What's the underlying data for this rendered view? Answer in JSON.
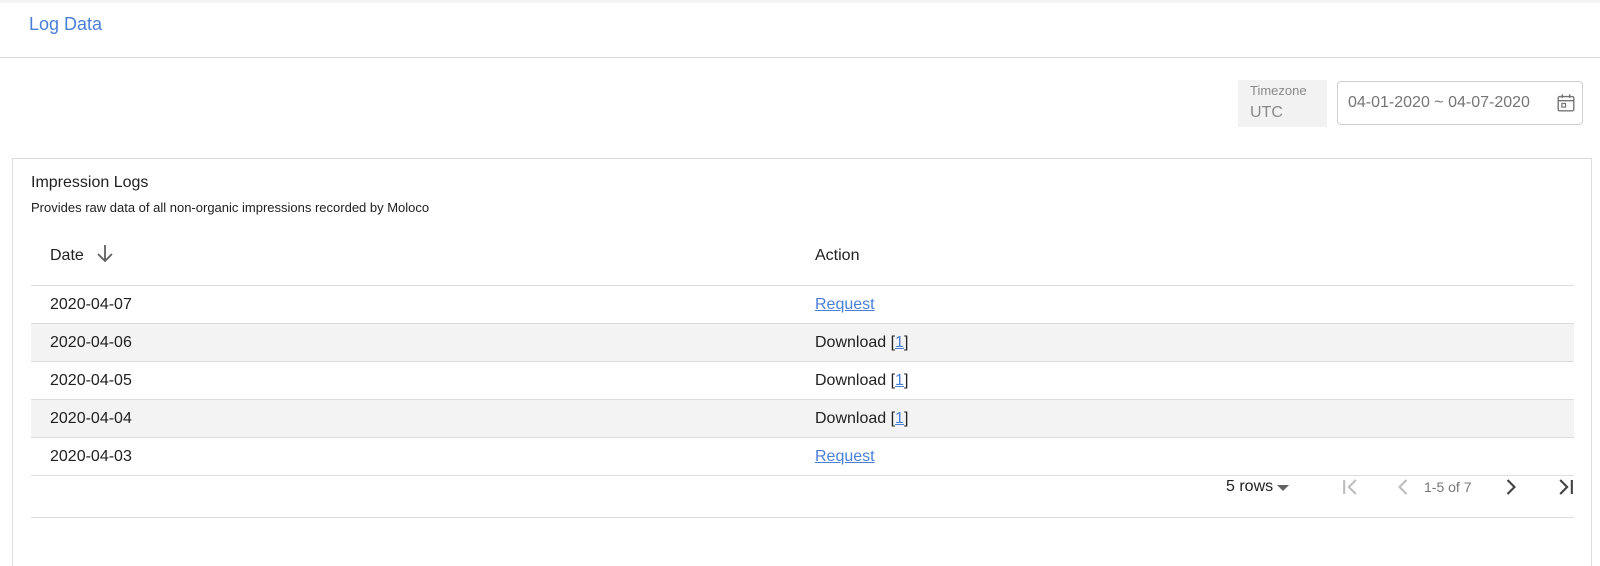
{
  "header": {
    "title": "Log Data"
  },
  "filters": {
    "timezone_label": "Timezone",
    "timezone_value": "UTC",
    "date_range": "04-01-2020 ~ 04-07-2020"
  },
  "card": {
    "title": "Impression Logs",
    "subtitle": "Provides raw data of all non-organic impressions recorded by Moloco"
  },
  "table": {
    "columns": [
      "Date",
      "Action"
    ],
    "rows": [
      {
        "date": "2020-04-07",
        "action_type": "request",
        "action_label": "Request"
      },
      {
        "date": "2020-04-06",
        "action_type": "download",
        "action_label": "Download",
        "files": [
          "1"
        ]
      },
      {
        "date": "2020-04-05",
        "action_type": "download",
        "action_label": "Download",
        "files": [
          "1"
        ]
      },
      {
        "date": "2020-04-04",
        "action_type": "download",
        "action_label": "Download",
        "files": [
          "1"
        ]
      },
      {
        "date": "2020-04-03",
        "action_type": "request",
        "action_label": "Request"
      }
    ]
  },
  "pagination": {
    "rows_per_page": "5 rows",
    "range_text": "1-5 of 7"
  },
  "colors": {
    "link": "#4a7fd8",
    "row_alt": "#f3f3f3",
    "border": "#dcdcdc"
  },
  "icons": {
    "sort": "arrow-down-icon",
    "calendar": "calendar-icon",
    "first": "first-page-icon",
    "prev": "chevron-left-icon",
    "next": "chevron-right-icon",
    "last": "last-page-icon"
  }
}
